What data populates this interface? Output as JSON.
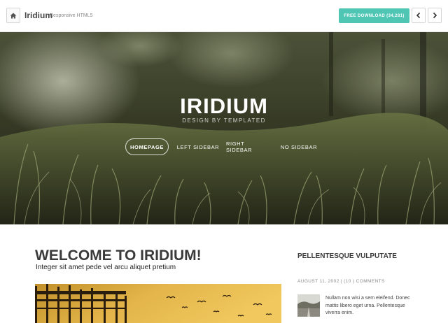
{
  "topbar": {
    "home_icon": "home-icon",
    "brand_name": "Iridium",
    "brand_tagline": "Responsive HTML5",
    "download_label": "FREE DOWNLOAD (34,281)",
    "prev_icon": "chevron-left-icon",
    "next_icon": "chevron-right-icon",
    "accent_color": "#4fc6b4"
  },
  "hero": {
    "title": "IRIDIUM",
    "subtitle": "DESIGN BY TEMPLATED",
    "nav": [
      {
        "label": "HOMEPAGE",
        "active": true
      },
      {
        "label": "LEFT SIDEBAR",
        "active": false
      },
      {
        "label": "RIGHT SIDEBAR",
        "active": false
      },
      {
        "label": "NO SIDEBAR",
        "active": false
      }
    ]
  },
  "main": {
    "heading": "WELCOME TO IRIDIUM!",
    "subheading": "Integer sit amet pede vel arcu aliquet pretium"
  },
  "sidebar": {
    "title": "PELLENTESQUE VULPUTATE",
    "meta": "AUGUST 11, 2002 | (10 ) COMMENTS",
    "text": "Nullam non wisi a sem eleifend. Donec mattis libero eget urna. Pellentesque viverra enim."
  }
}
